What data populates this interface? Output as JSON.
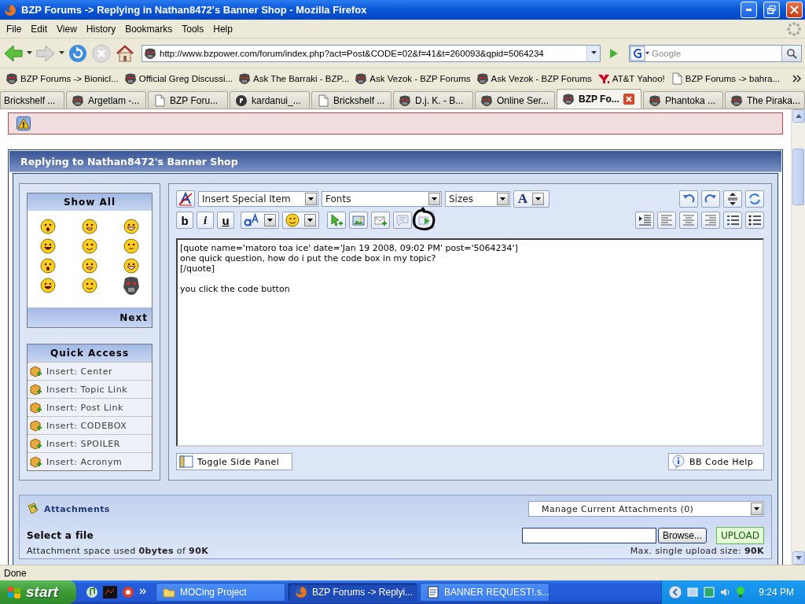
{
  "window": {
    "title": "BZP Forums -> Replying in Nathan8472's Banner Shop - Mozilla Firefox"
  },
  "menu": [
    "File",
    "Edit",
    "View",
    "History",
    "Bookmarks",
    "Tools",
    "Help"
  ],
  "navigation": {
    "url": "http://www.bzpower.com/forum/index.php?act=Post&CODE=02&f=41&t=260093&qpid=5064234",
    "search_placeholder": "Google"
  },
  "bookmarks": [
    {
      "label": "BZP Forums -> Bionicl...",
      "kind": "mask"
    },
    {
      "label": "Official Greg Discussi...",
      "kind": "mask"
    },
    {
      "label": "Ask The Barraki - BZP...",
      "kind": "mask"
    },
    {
      "label": "Ask Vezok - BZP Forums",
      "kind": "mask"
    },
    {
      "label": "Ask Vezok - BZP Forums",
      "kind": "mask"
    },
    {
      "label": "AT&T Yahoo!",
      "kind": "yahoo"
    },
    {
      "label": "BZP Forums -> bahra...",
      "kind": "page"
    }
  ],
  "tabs": [
    {
      "label": "Brickshelf ...",
      "kind": "none",
      "selected": false
    },
    {
      "label": "Argetlam -...",
      "kind": "mask",
      "selected": false
    },
    {
      "label": "BZP Foru...",
      "kind": "page",
      "selected": false
    },
    {
      "label": "kardanui_...",
      "kind": "puzzle",
      "selected": false
    },
    {
      "label": "Brickshelf ...",
      "kind": "page",
      "selected": false
    },
    {
      "label": "D.j. K. - B...",
      "kind": "mask",
      "selected": false
    },
    {
      "label": "Online Ser...",
      "kind": "mask",
      "selected": false
    },
    {
      "label": "BZP Fo...",
      "kind": "mask",
      "selected": true
    },
    {
      "label": "Phantoka ...",
      "kind": "mask",
      "selected": false
    },
    {
      "label": "The Piraka...",
      "kind": "mask",
      "selected": false
    }
  ],
  "page": {
    "panel_title": "Replying to Nathan8472's Banner Shop",
    "smilies": {
      "title": "Show All",
      "next": "Next"
    },
    "quick_access": {
      "title": "Quick Access",
      "items": [
        "Insert: Center",
        "Insert: Topic Link",
        "Insert: Post Link",
        "Insert: CODEBOX",
        "Insert: SPOILER",
        "Insert: Acronym"
      ]
    },
    "editor": {
      "dropdowns": [
        "Insert Special Item",
        "Fonts",
        "Sizes"
      ],
      "color_button": "A",
      "format_buttons": [
        "b",
        "i",
        "u"
      ],
      "text": "[quote name='matoro toa ice' date='Jan 19 2008, 09:02 PM' post='5064234']\none quick question, how do i put the code box in my topic?\n[/quote]\n\nyou click the code button ",
      "buttons": [
        {
          "label": "Toggle Side Panel",
          "kind": "panel"
        },
        {
          "label": "BB Code Help",
          "kind": "help"
        }
      ]
    },
    "attachments": {
      "title": "Attachments",
      "manage": "Manage Current Attachments (0)",
      "select_label": "Select a file",
      "browse": "Browse...",
      "upload": "UPLOAD",
      "space_used": "Attachment space used **0bytes** of **90K**",
      "max_size": "Max. single upload size: **90K**"
    }
  },
  "status": "Done",
  "taskbar": {
    "start": "start",
    "windows": [
      {
        "label": "MOCing Project",
        "kind": "folder",
        "selected": false
      },
      {
        "label": "BZP Forums -> Replyi...",
        "kind": "firefox",
        "selected": true
      },
      {
        "label": "BANNER REQUEST!.s...",
        "kind": "document",
        "selected": false
      }
    ],
    "clock": "9:24 PM"
  }
}
